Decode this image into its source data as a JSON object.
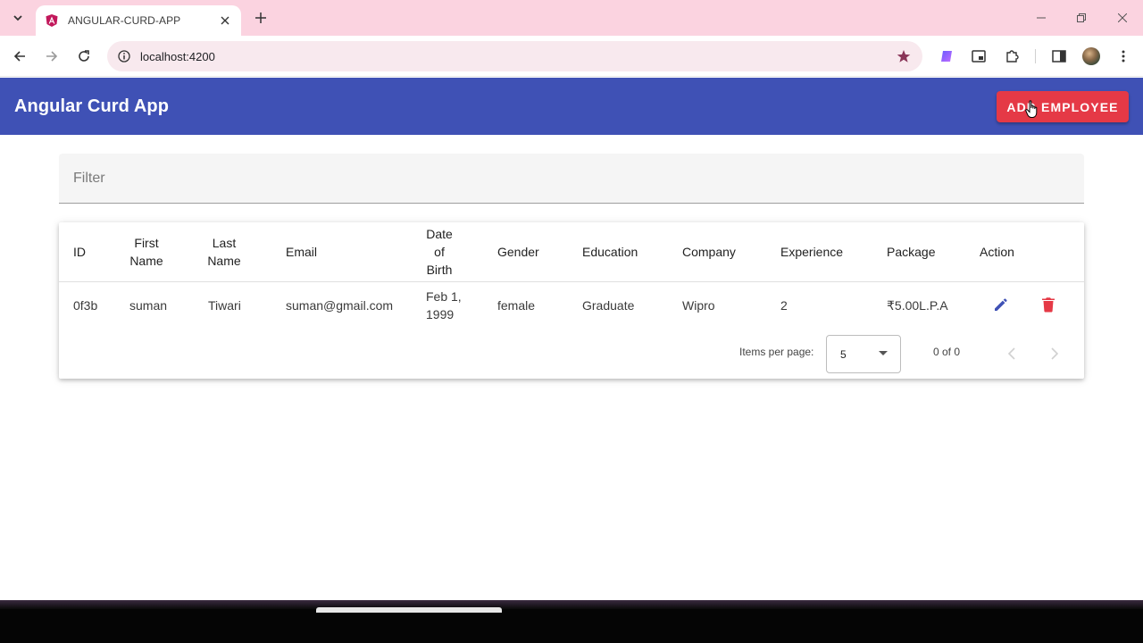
{
  "browser": {
    "tab_title": "ANGULAR-CURD-APP",
    "url": "localhost:4200"
  },
  "app": {
    "title": "Angular Curd App",
    "add_button_label": "ADD EMPLOYEE",
    "filter_placeholder": "Filter"
  },
  "table": {
    "headers": {
      "id": "ID",
      "first_name": "First Name",
      "last_name": "Last Name",
      "email": "Email",
      "dob": "Date of Birth",
      "gender": "Gender",
      "education": "Education",
      "company": "Company",
      "experience": "Experience",
      "package": "Package",
      "action": "Action"
    },
    "rows": [
      {
        "id": "0f3b",
        "first_name": "suman",
        "last_name": "Tiwari",
        "email": "suman@gmail.com",
        "dob": "Feb 1, 1999",
        "gender": "female",
        "education": "Graduate",
        "company": "Wipro",
        "experience": "2",
        "package": "₹5.00L.P.A"
      }
    ]
  },
  "paginator": {
    "items_per_page_label": "Items per page:",
    "items_per_page_value": "5",
    "range_label": "0 of 0"
  },
  "colors": {
    "primary": "#3f51b5",
    "warn": "#e53946"
  },
  "icons": {
    "edit": "pencil-icon",
    "delete": "trash-icon"
  }
}
